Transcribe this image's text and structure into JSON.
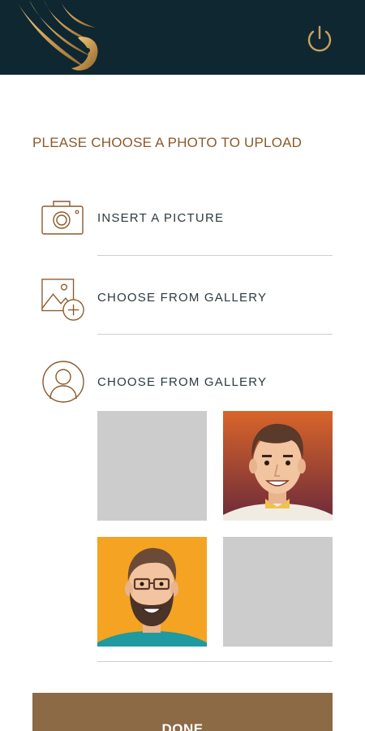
{
  "header": {
    "logo_icon": "golden-wing-logo",
    "power_icon": "power-icon"
  },
  "prompt": "PLEASE CHOOSE A PHOTO TO UPLOAD",
  "options": [
    {
      "icon": "camera-icon",
      "label": "INSERT A PICTURE"
    },
    {
      "icon": "gallery-add-icon",
      "label": "CHOOSE FROM GALLERY"
    },
    {
      "icon": "user-avatar-icon",
      "label": "CHOOSE FROM GALLERY"
    }
  ],
  "avatars": [
    {
      "type": "placeholder"
    },
    {
      "type": "young-man-avatar",
      "background": "#c4552a"
    },
    {
      "type": "bearded-man-glasses-avatar",
      "background": "#f4a323"
    },
    {
      "type": "placeholder"
    }
  ],
  "done_label": "DONE",
  "colors": {
    "header_bg": "#0f2730",
    "accent_brown": "#8b5a2b",
    "gold": "#c9a060",
    "button_bg": "#8c6a45"
  }
}
